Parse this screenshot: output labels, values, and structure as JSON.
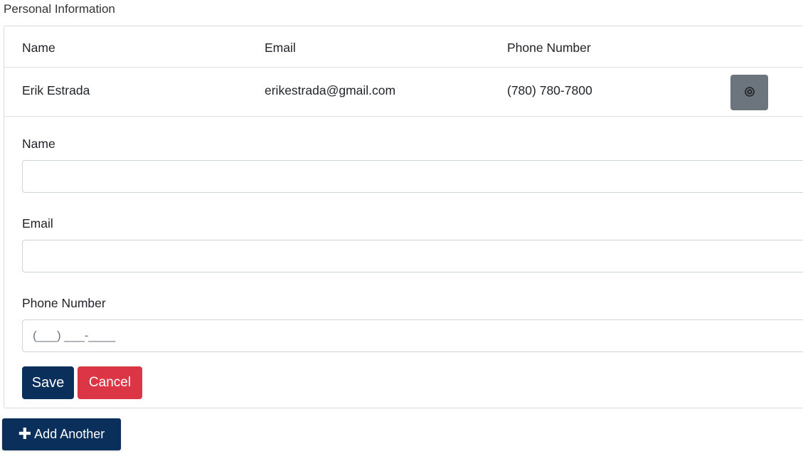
{
  "section": {
    "title": "Personal Information"
  },
  "table": {
    "headers": [
      "Name",
      "Email",
      "Phone Number"
    ],
    "rows": [
      {
        "name": "Erik Estrada",
        "email": "erikestrada@gmail.com",
        "phone": "(780) 780-7800",
        "remove_icon": "close-circle-icon"
      }
    ]
  },
  "form": {
    "name_label": "Name",
    "name_value": "",
    "email_label": "Email",
    "email_value": "",
    "phone_label": "Phone Number",
    "phone_placeholder": "(___) ___-____",
    "save_label": "Save",
    "cancel_label": "Cancel"
  },
  "add_button": {
    "icon": "plus-icon",
    "label": "Add Another"
  },
  "colors": {
    "primary": "#0b2f5b",
    "danger": "#dc3545",
    "secondary": "#6c757d"
  }
}
